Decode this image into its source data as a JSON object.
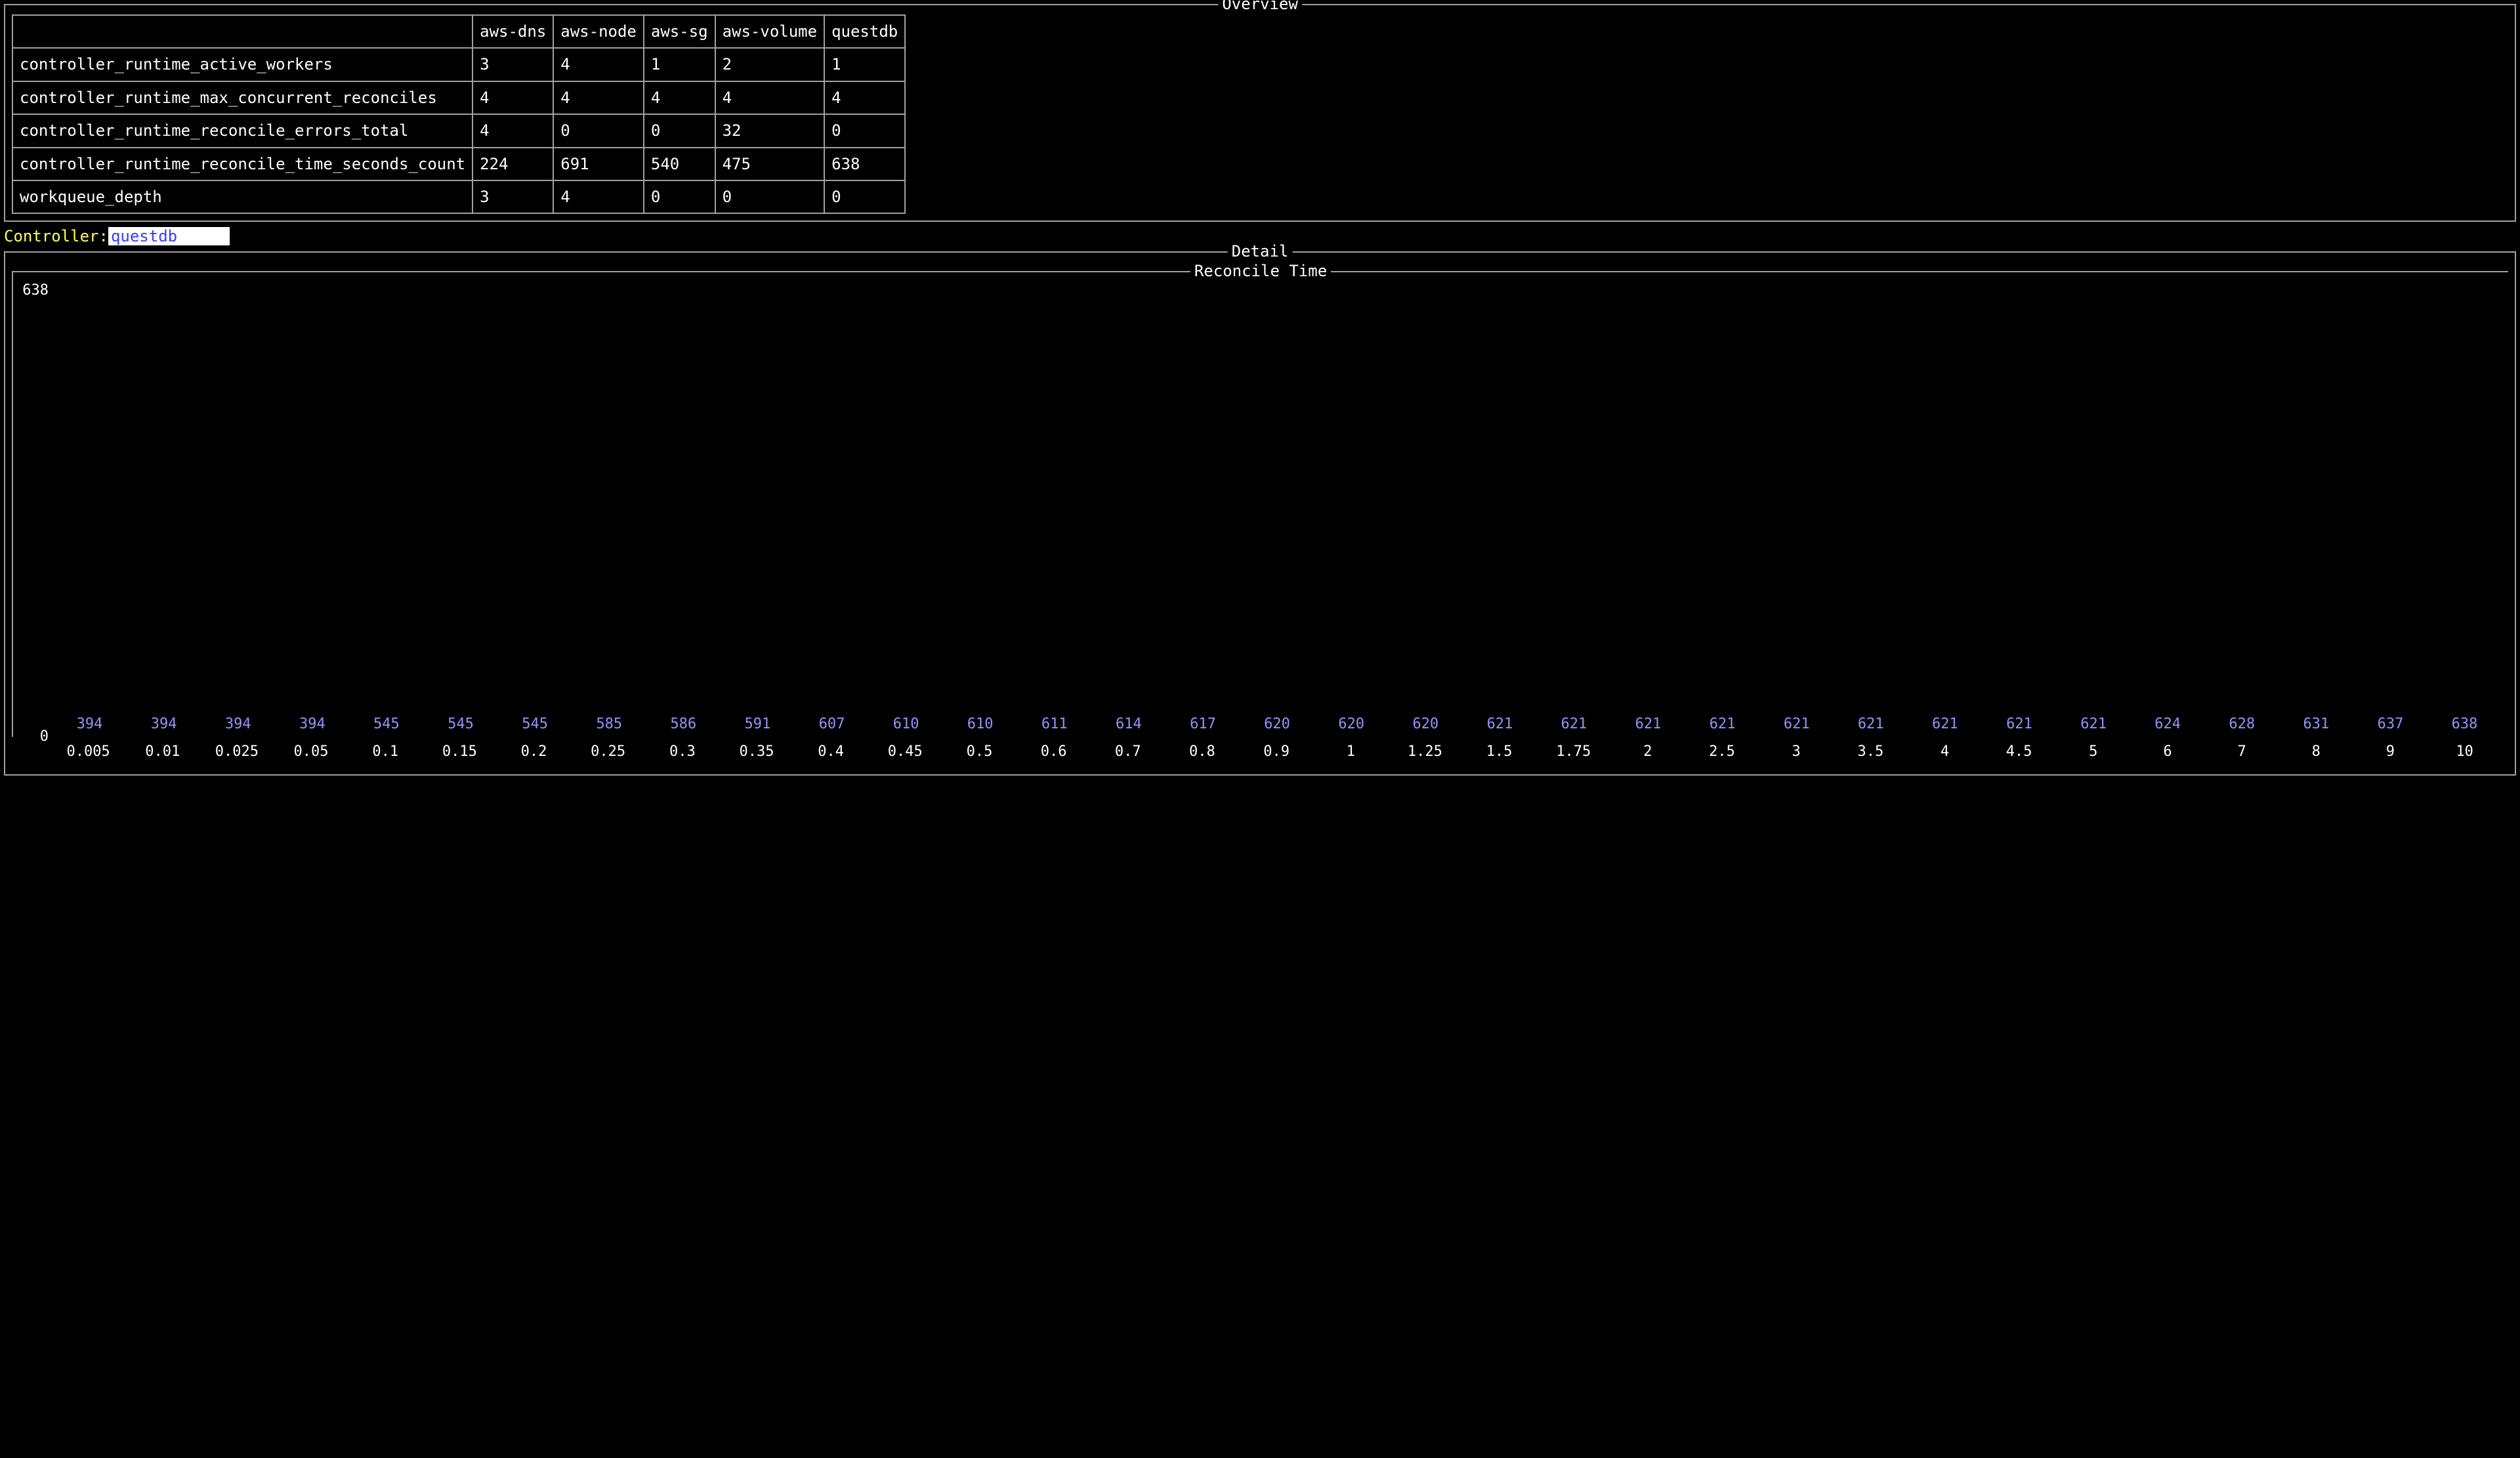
{
  "overview": {
    "title": "Overview",
    "columns": [
      "aws-dns",
      "aws-node",
      "aws-sg",
      "aws-volume",
      "questdb"
    ],
    "rows": [
      {
        "metric": "controller_runtime_active_workers",
        "values": [
          "3",
          "4",
          "1",
          "2",
          "1"
        ]
      },
      {
        "metric": "controller_runtime_max_concurrent_reconciles",
        "values": [
          "4",
          "4",
          "4",
          "4",
          "4"
        ]
      },
      {
        "metric": "controller_runtime_reconcile_errors_total",
        "values": [
          "4",
          "0",
          "0",
          "32",
          "0"
        ]
      },
      {
        "metric": "controller_runtime_reconcile_time_seconds_count",
        "values": [
          "224",
          "691",
          "540",
          "475",
          "638"
        ]
      },
      {
        "metric": "workqueue_depth",
        "values": [
          "3",
          "4",
          "0",
          "0",
          "0"
        ]
      }
    ]
  },
  "controller": {
    "label": "Controller:",
    "value": "questdb"
  },
  "detail": {
    "title": "Detail",
    "subtitle": "Reconcile Time"
  },
  "chart_data": {
    "type": "bar",
    "title": "Reconcile Time",
    "xlabel": "",
    "ylabel": "",
    "ylim": [
      0,
      638
    ],
    "categories": [
      "0.005",
      "0.01",
      "0.025",
      "0.05",
      "0.1",
      "0.15",
      "0.2",
      "0.25",
      "0.3",
      "0.35",
      "0.4",
      "0.45",
      "0.5",
      "0.6",
      "0.7",
      "0.8",
      "0.9",
      "1",
      "1.25",
      "1.5",
      "1.75",
      "2",
      "2.5",
      "3",
      "3.5",
      "4",
      "4.5",
      "5",
      "6",
      "7",
      "8",
      "9",
      "10"
    ],
    "values": [
      394,
      394,
      394,
      394,
      545,
      545,
      545,
      585,
      586,
      591,
      607,
      610,
      610,
      611,
      614,
      617,
      620,
      620,
      620,
      621,
      621,
      621,
      621,
      621,
      621,
      621,
      621,
      621,
      624,
      628,
      631,
      637,
      638
    ],
    "y_ticks": [
      638,
      0
    ]
  }
}
